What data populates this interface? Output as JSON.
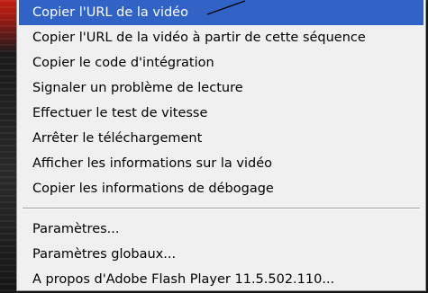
{
  "context_menu": {
    "items": [
      {
        "label": "Copier l'URL de la vidéo",
        "selected": true
      },
      {
        "label": "Copier l'URL de la vidéo à partir de cette séquence"
      },
      {
        "label": "Copier le code d'intégration"
      },
      {
        "label": "Signaler un problème de lecture"
      },
      {
        "label": "Effectuer le test de vitesse"
      },
      {
        "label": "Arrêter le téléchargement"
      },
      {
        "label": "Afficher les informations sur la vidéo"
      },
      {
        "label": "Copier les informations de débogage"
      }
    ],
    "flash_items": [
      {
        "label": "Paramètres..."
      },
      {
        "label": "Paramètres globaux..."
      },
      {
        "label": "A propos d'Adobe Flash Player 11.5.502.110..."
      }
    ]
  },
  "colors": {
    "menu_background": "#f0f0f0",
    "highlight": "#3162c5",
    "highlight_text": "#ffffff",
    "text": "#000000",
    "separator": "#a0a0a0",
    "backdrop_accent": "#c41e14"
  }
}
